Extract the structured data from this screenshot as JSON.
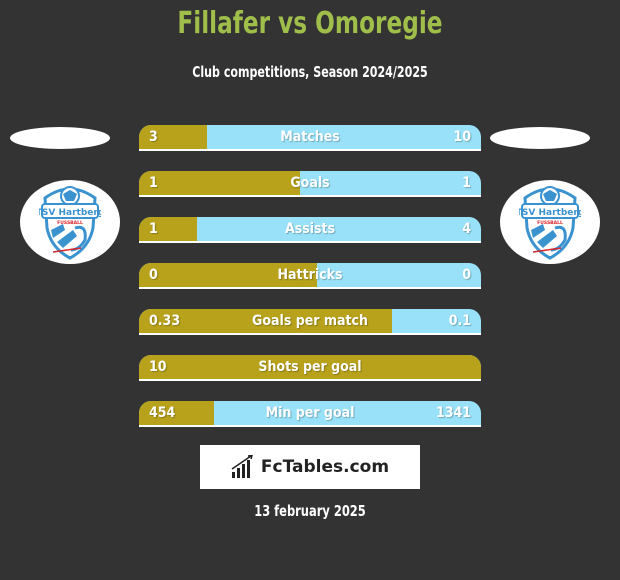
{
  "header": {
    "title": "Fillafer vs Omoregie",
    "subtitle": "Club competitions, Season 2024/2025"
  },
  "players": {
    "left": {
      "club_logo": "TSV Hartberg Fussball",
      "logo_text": "TSV Hartberg",
      "logo_sub": "FUSSBALL"
    },
    "right": {
      "club_logo": "TSV Hartberg Fussball",
      "logo_text": "TSV Hartberg",
      "logo_sub": "FUSSBALL"
    }
  },
  "colors": {
    "left": "#b8a21b",
    "right": "#98e1f8",
    "title": "#9fbe4a",
    "background": "#333333"
  },
  "stats": [
    {
      "label": "Matches",
      "left": "3",
      "right": "10",
      "left_share": 0.2
    },
    {
      "label": "Goals",
      "left": "1",
      "right": "1",
      "left_share": 0.47
    },
    {
      "label": "Assists",
      "left": "1",
      "right": "4",
      "left_share": 0.17
    },
    {
      "label": "Hattricks",
      "left": "0",
      "right": "0",
      "left_share": 0.52
    },
    {
      "label": "Goals per match",
      "left": "0.33",
      "right": "0.1",
      "left_share": 0.74
    },
    {
      "label": "Shots per goal",
      "left": "10",
      "right": "",
      "left_share": 1.0
    },
    {
      "label": "Min per goal",
      "left": "454",
      "right": "1341",
      "left_share": 0.22
    }
  ],
  "footer": {
    "brand": "FcTables.com",
    "brand_icon": "bar-chart-icon",
    "date": "13 february 2025"
  }
}
